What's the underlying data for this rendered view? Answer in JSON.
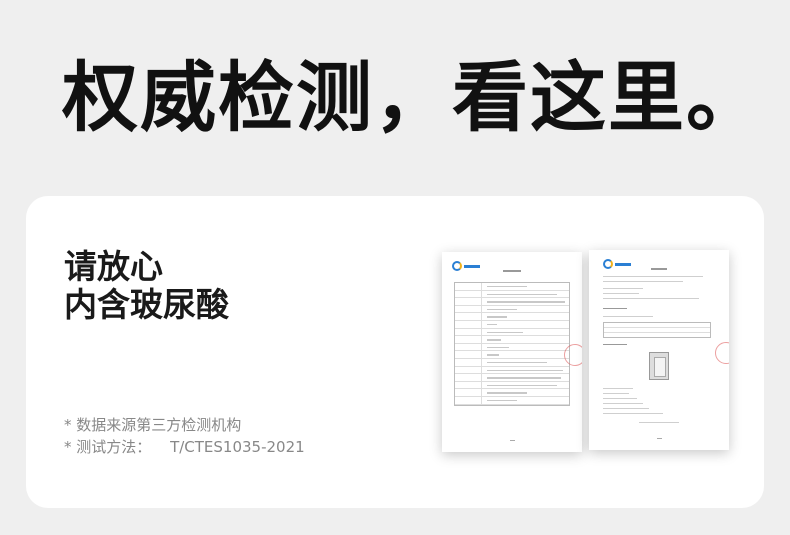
{
  "headline": "权威检测，看这里。",
  "card": {
    "slogan_line1": "请放心",
    "slogan_line2": "内含玻尿酸",
    "note_source": "* 数据来源第三方检测机构",
    "note_method_label": "* 测试方法：",
    "note_method_value": "T/CTES1035-2021"
  },
  "documents": [
    {
      "id": "report-page-1",
      "logo_icon": "company-logo-icon"
    },
    {
      "id": "report-page-2",
      "logo_icon": "company-logo-icon"
    }
  ],
  "colors": {
    "background": "#efefef",
    "card": "#ffffff",
    "headline": "#111111",
    "note": "#888888",
    "logo_blue": "#2a7fd4",
    "stamp_red": "#dc5050"
  }
}
